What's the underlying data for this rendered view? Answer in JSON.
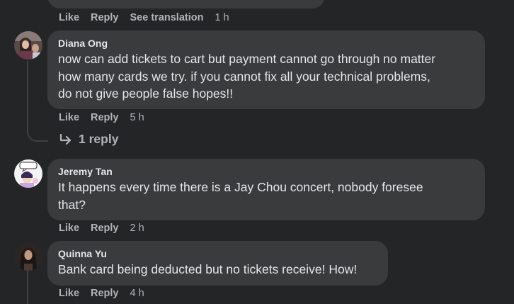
{
  "top_comment": {
    "like": "Like",
    "reply": "Reply",
    "see_translation": "See translation",
    "time": "1 h"
  },
  "comments": [
    {
      "author": "Diana Ong",
      "text_lines": [
        "now can add tickets to cart but payment cannot go through no matter",
        "how many cards we try. if you cannot fix all your technical problems,",
        "do not give people false hopes!!"
      ],
      "like": "Like",
      "reply": "Reply",
      "time": "5 h",
      "replies_label": "1 reply"
    },
    {
      "author": "Jeremy Tan",
      "text_lines": [
        "It happens every time there is a Jay Chou concert, nobody foresee",
        "that?"
      ],
      "like": "Like",
      "reply": "Reply",
      "time": "2 h"
    },
    {
      "author": "Quinna Yu",
      "text_lines": [
        "Bank card being deducted but no tickets receive! How!"
      ],
      "like": "Like",
      "reply": "Reply",
      "time": "4 h"
    }
  ],
  "colors": {
    "background": "#242526",
    "bubble": "#3a3b3c",
    "text": "#e4e6eb",
    "secondary_text": "#b0b3b8"
  }
}
